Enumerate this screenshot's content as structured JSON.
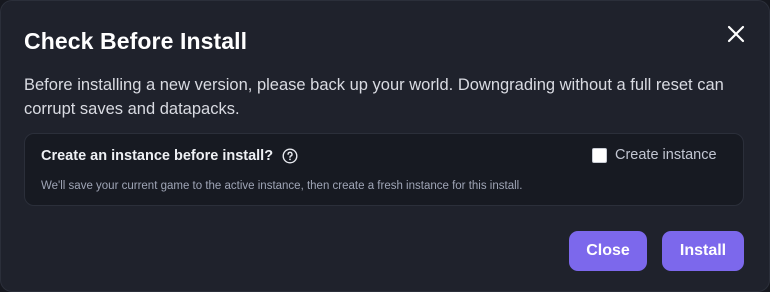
{
  "dialog": {
    "title": "Check Before Install",
    "message": "Before installing a new version, please back up your world. Downgrading without a full reset can corrupt saves and datapacks.",
    "panel": {
      "question": "Create an instance before install?",
      "description": "We'll save your current game to the active instance, then create a fresh instance for this install.",
      "checkbox_label": "Create instance",
      "checkbox_checked": false
    },
    "buttons": {
      "close_label": "Close",
      "install_label": "Install"
    },
    "icons": {
      "close": "close-icon",
      "help": "help-circle-icon"
    },
    "colors": {
      "accent": "#7c68ec",
      "background": "#1f222c",
      "panel_background": "#171a22"
    }
  }
}
